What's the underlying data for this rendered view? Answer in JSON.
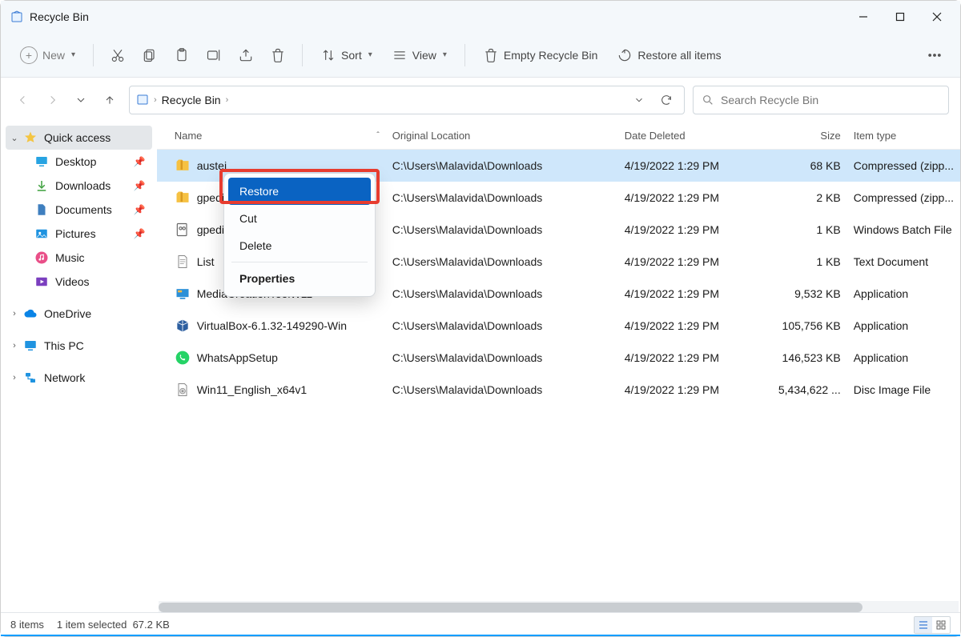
{
  "titlebar": {
    "title": "Recycle Bin"
  },
  "toolbar": {
    "new_label": "New",
    "sort_label": "Sort",
    "view_label": "View",
    "empty_label": "Empty Recycle Bin",
    "restore_all_label": "Restore all items"
  },
  "address": {
    "crumb": "Recycle Bin"
  },
  "search": {
    "placeholder": "Search Recycle Bin"
  },
  "sidebar": {
    "quick_access": "Quick access",
    "items": [
      {
        "label": "Desktop",
        "pinned": true,
        "icon": "desktop"
      },
      {
        "label": "Downloads",
        "pinned": true,
        "icon": "download"
      },
      {
        "label": "Documents",
        "pinned": true,
        "icon": "document"
      },
      {
        "label": "Pictures",
        "pinned": true,
        "icon": "pictures"
      },
      {
        "label": "Music",
        "pinned": false,
        "icon": "music"
      },
      {
        "label": "Videos",
        "pinned": false,
        "icon": "video"
      }
    ],
    "onedrive": "OneDrive",
    "thispc": "This PC",
    "network": "Network"
  },
  "columns": {
    "name": "Name",
    "location": "Original Location",
    "date": "Date Deleted",
    "size": "Size",
    "type": "Item type"
  },
  "files": [
    {
      "name": "austei",
      "icon": "zip",
      "loc": "C:\\Users\\Malavida\\Downloads",
      "date": "4/19/2022 1:29 PM",
      "size": "68 KB",
      "type": "Compressed (zipp...",
      "selected": true
    },
    {
      "name": "gpedi",
      "icon": "zip",
      "loc": "C:\\Users\\Malavida\\Downloads",
      "date": "4/19/2022 1:29 PM",
      "size": "2 KB",
      "type": "Compressed (zipp..."
    },
    {
      "name": "gpedi",
      "icon": "bat",
      "loc": "C:\\Users\\Malavida\\Downloads",
      "date": "4/19/2022 1:29 PM",
      "size": "1 KB",
      "type": "Windows Batch File"
    },
    {
      "name": "List",
      "icon": "txt",
      "loc": "C:\\Users\\Malavida\\Downloads",
      "date": "4/19/2022 1:29 PM",
      "size": "1 KB",
      "type": "Text Document"
    },
    {
      "name": "MediaCreationToolW11",
      "icon": "exe-blue",
      "loc": "C:\\Users\\Malavida\\Downloads",
      "date": "4/19/2022 1:29 PM",
      "size": "9,532 KB",
      "type": "Application"
    },
    {
      "name": "VirtualBox-6.1.32-149290-Win",
      "icon": "vbox",
      "loc": "C:\\Users\\Malavida\\Downloads",
      "date": "4/19/2022 1:29 PM",
      "size": "105,756 KB",
      "type": "Application"
    },
    {
      "name": "WhatsAppSetup",
      "icon": "whatsapp",
      "loc": "C:\\Users\\Malavida\\Downloads",
      "date": "4/19/2022 1:29 PM",
      "size": "146,523 KB",
      "type": "Application"
    },
    {
      "name": "Win11_English_x64v1",
      "icon": "iso",
      "loc": "C:\\Users\\Malavida\\Downloads",
      "date": "4/19/2022 1:29 PM",
      "size": "5,434,622 ...",
      "type": "Disc Image File"
    }
  ],
  "context_menu": {
    "items": [
      {
        "label": "Restore",
        "highlight": true
      },
      {
        "label": "Cut"
      },
      {
        "label": "Delete"
      },
      {
        "sep": true
      },
      {
        "label": "Properties",
        "bold": true
      }
    ]
  },
  "status": {
    "count": "8 items",
    "selection": "1 item selected",
    "size": "67.2 KB"
  }
}
